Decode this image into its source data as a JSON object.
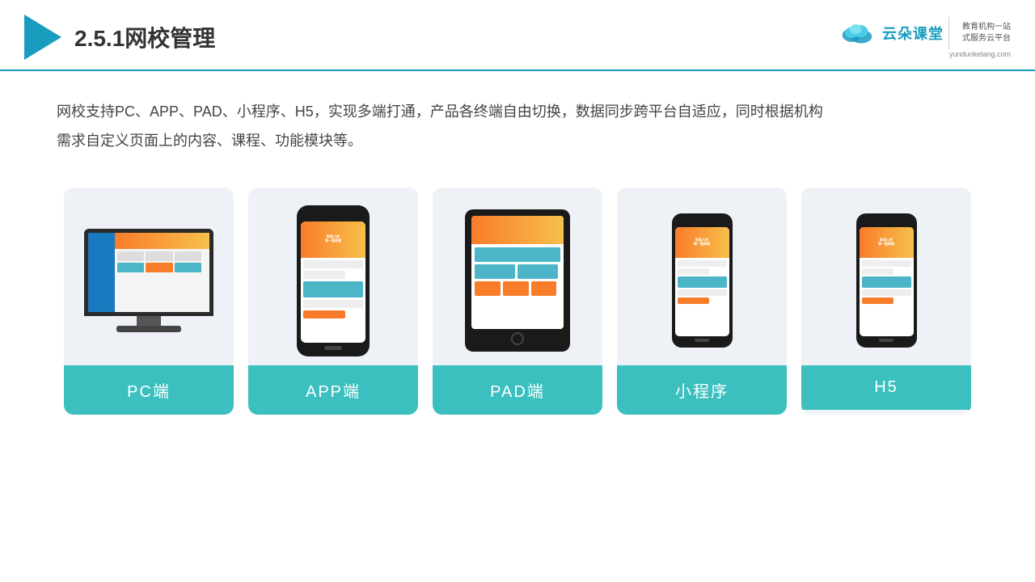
{
  "header": {
    "title": "2.5.1网校管理",
    "brand_cn": "云朵课堂",
    "brand_url": "yunduoketang.com",
    "brand_tagline": "教育机构一站\n式服务云平台"
  },
  "description": "网校支持PC、APP、PAD、小程序、H5，实现多端打通，产品各终端自由切换，数据同步跨平台自适应，同时根据机构\n需求自定义页面上的内容、课程、功能模块等。",
  "cards": [
    {
      "id": "pc",
      "label": "PC端"
    },
    {
      "id": "app",
      "label": "APP端"
    },
    {
      "id": "pad",
      "label": "PAD端"
    },
    {
      "id": "mini",
      "label": "小程序"
    },
    {
      "id": "h5",
      "label": "H5"
    }
  ],
  "colors": {
    "accent": "#1a9cbf",
    "card_bg": "#eef2f7",
    "card_label": "#3bbfbf",
    "gradient_start": "#f97c2a",
    "gradient_end": "#f7c04b"
  }
}
